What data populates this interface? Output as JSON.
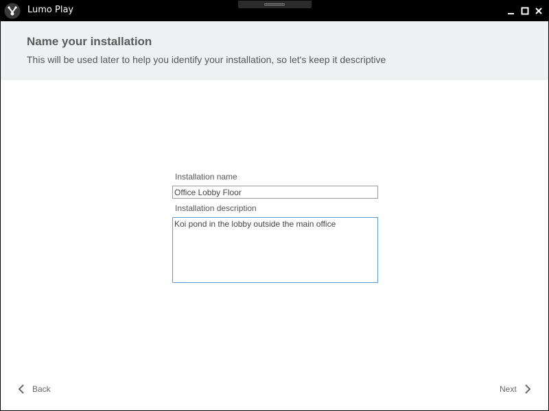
{
  "window": {
    "title": "Lumo Play"
  },
  "header": {
    "title": "Name your installation",
    "subtitle": "This will be used later to help you identify your installation, so let's keep it descriptive"
  },
  "form": {
    "name_label": "Installation name",
    "name_value": "Office Lobby Floor",
    "description_label": "Installation description",
    "description_value": "Koi pond in the lobby outside the main office"
  },
  "footer": {
    "back_label": "Back",
    "next_label": "Next"
  },
  "icons": {
    "app": "lumo-logo-icon",
    "minimize": "minimize-icon",
    "maximize": "maximize-icon",
    "close": "close-icon",
    "back": "chevron-left-icon",
    "next": "chevron-right-icon"
  },
  "colors": {
    "titlebar": "#000000",
    "header_bg": "#eef1f2",
    "focus_border": "#5a9bd4"
  }
}
